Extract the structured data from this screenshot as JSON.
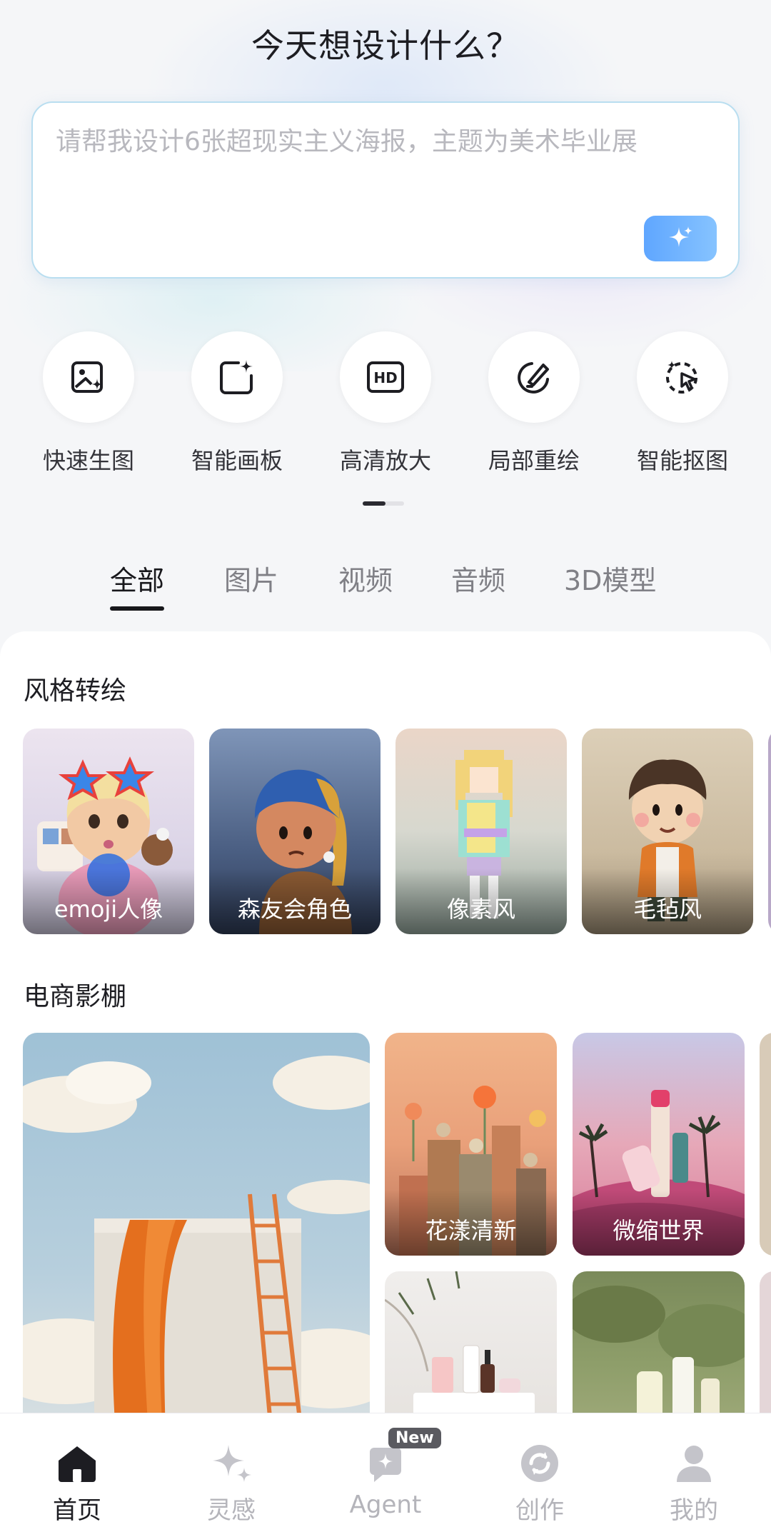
{
  "header": {
    "title": "今天想设计什么？"
  },
  "prompt": {
    "placeholder": "请帮我设计6张超现实主义海报，主题为美术毕业展",
    "send_icon": "sparkle-icon",
    "accent": "#5fa6ff"
  },
  "tools": [
    {
      "label": "快速生图",
      "icon": "image-sparkle-icon"
    },
    {
      "label": "智能画板",
      "icon": "canvas-sparkle-icon"
    },
    {
      "label": "高清放大",
      "icon": "hd-icon"
    },
    {
      "label": "局部重绘",
      "icon": "brush-icon"
    },
    {
      "label": "智能抠图",
      "icon": "lasso-icon"
    }
  ],
  "tabs": [
    {
      "label": "全部",
      "active": true
    },
    {
      "label": "图片"
    },
    {
      "label": "视频"
    },
    {
      "label": "音频"
    },
    {
      "label": "3D模型"
    }
  ],
  "sections": {
    "style": {
      "title": "风格转绘",
      "cards": [
        {
          "label": "emoji人像"
        },
        {
          "label": "森友会角色"
        },
        {
          "label": "像素风"
        },
        {
          "label": "毛毡风"
        }
      ]
    },
    "ecommerce": {
      "title": "电商影棚",
      "cards": [
        {
          "label": "花漾清新"
        },
        {
          "label": "微缩世界"
        }
      ]
    }
  },
  "nav": [
    {
      "label": "首页",
      "icon": "home-icon",
      "active": true
    },
    {
      "label": "灵感",
      "icon": "sparkle-icon"
    },
    {
      "label": "Agent",
      "icon": "agent-icon",
      "badge": "New"
    },
    {
      "label": "创作",
      "icon": "create-icon"
    },
    {
      "label": "我的",
      "icon": "profile-icon"
    }
  ]
}
